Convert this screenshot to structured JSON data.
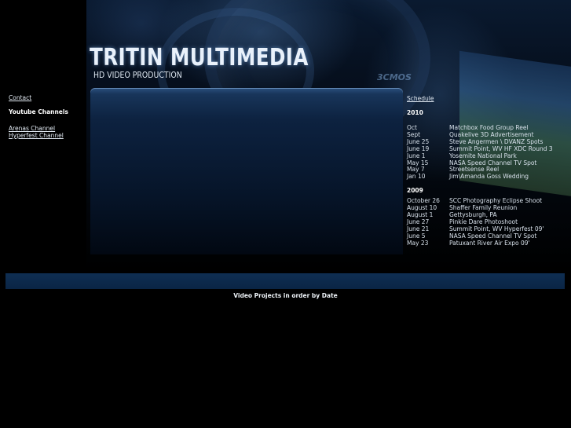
{
  "header": {
    "title": "TRITIN MULTIMEDIA",
    "subtitle": "HD VIDEO PRODUCTION",
    "camera_label": "3CMOS"
  },
  "left_nav": {
    "contact": "Contact",
    "youtube_heading": "Youtube Channels",
    "channels": [
      "Arenas Channel",
      "Hyperfest Channel"
    ]
  },
  "schedule": {
    "link": "Schedule",
    "years": [
      {
        "year": "2010",
        "entries": [
          {
            "date": "Oct",
            "title": "Matchbox Food Group Reel"
          },
          {
            "date": "Sept",
            "title": "Quakelive 3D Advertisement"
          },
          {
            "date": "June 25",
            "title": "Steve Angermen \\ DVANZ Spots"
          },
          {
            "date": "June 19",
            "title": "Summit Point, WV HF XDC Round 3"
          },
          {
            "date": "June 1",
            "title": "Yosemite National Park"
          },
          {
            "date": "May 15",
            "title": "NASA Speed Channel TV Spot"
          },
          {
            "date": "May 7",
            "title": "Streetsense Reel"
          },
          {
            "date": "Jan 10",
            "title": "Jim\\Amanda Goss Wedding"
          }
        ]
      },
      {
        "year": "2009",
        "entries": [
          {
            "date": "October 26",
            "title": "SCC Photography Eclipse Shoot"
          },
          {
            "date": "August 10",
            "title": "Shaffer Family Reunion"
          },
          {
            "date": "August 1",
            "title": "Gettysburgh, PA"
          },
          {
            "date": "June 27",
            "title": "Pinkie Dare Photoshoot"
          },
          {
            "date": "June 21",
            "title": "Summit Point, WV Hyperfest 09'"
          },
          {
            "date": "June 5",
            "title": "NASA Speed Channel TV Spot"
          },
          {
            "date": "May 23",
            "title": "Patuxant River Air Expo 09'"
          }
        ]
      }
    ]
  },
  "footer": {
    "caption": "Video Projects in order by Date"
  }
}
